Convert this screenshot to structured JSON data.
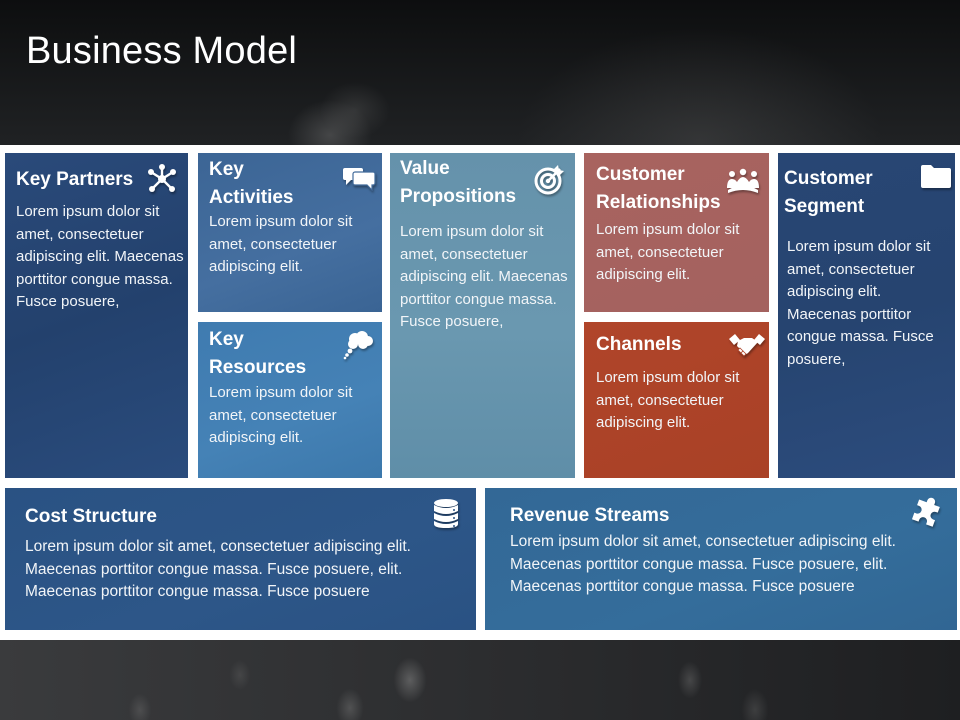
{
  "slide": {
    "title": "Business Model"
  },
  "cards": {
    "key_partners": {
      "title": "Key Partners",
      "icon": "network-icon",
      "text": "Lorem ipsum dolor sit amet, consectetuer adipiscing elit. Maecenas porttitor congue massa. Fusce posuere,",
      "color": "#274776"
    },
    "key_activities": {
      "title": "Key Activities",
      "icon": "chat-bubbles-icon",
      "text": "Lorem ipsum dolor sit amet, consectetuer adipiscing elit.",
      "color": "#426b9b"
    },
    "key_resources": {
      "title": "Key Resources",
      "icon": "thought-cloud-icon",
      "text": "Lorem ipsum dolor sit amet, consectetuer adipiscing elit.",
      "color": "#427db2"
    },
    "value_propositions": {
      "title": "Value Propositions",
      "icon": "target-icon",
      "text": "Lorem ipsum dolor sit amet, consectetuer adipiscing elit. Maecenas porttitor congue massa. Fusce posuere,",
      "color": "#6794ad"
    },
    "customer_relationships": {
      "title": "Customer Relationships",
      "icon": "group-meeting-icon",
      "text": "Lorem ipsum dolor sit amet, consectetuer adipiscing elit.",
      "color": "#a6635f"
    },
    "channels": {
      "title": "Channels",
      "icon": "handshake-icon",
      "text": "Lorem ipsum dolor sit amet, consectetuer adipiscing elit.",
      "color": "#ad4328"
    },
    "customer_segment": {
      "title": "Customer Segment",
      "icon": "folder-icon",
      "text": "Lorem ipsum dolor sit amet, consectetuer adipiscing elit. Maecenas porttitor congue massa. Fusce posuere,",
      "color": "#274573"
    },
    "cost_structure": {
      "title": "Cost Structure",
      "icon": "database-icon",
      "text": "Lorem ipsum dolor sit amet, consectetuer adipiscing elit. Maecenas porttitor congue massa. Fusce posuere, elit. Maecenas porttitor congue massa. Fusce posuere",
      "color": "#2b5485"
    },
    "revenue_streams": {
      "title": "Revenue Streams",
      "icon": "puzzle-piece-icon",
      "text": "Lorem ipsum dolor sit amet, consectetuer adipiscing elit. Maecenas porttitor congue massa. Fusce posuere, elit. Maecenas porttitor congue massa. Fusce posuere",
      "color": "#336a98"
    }
  }
}
